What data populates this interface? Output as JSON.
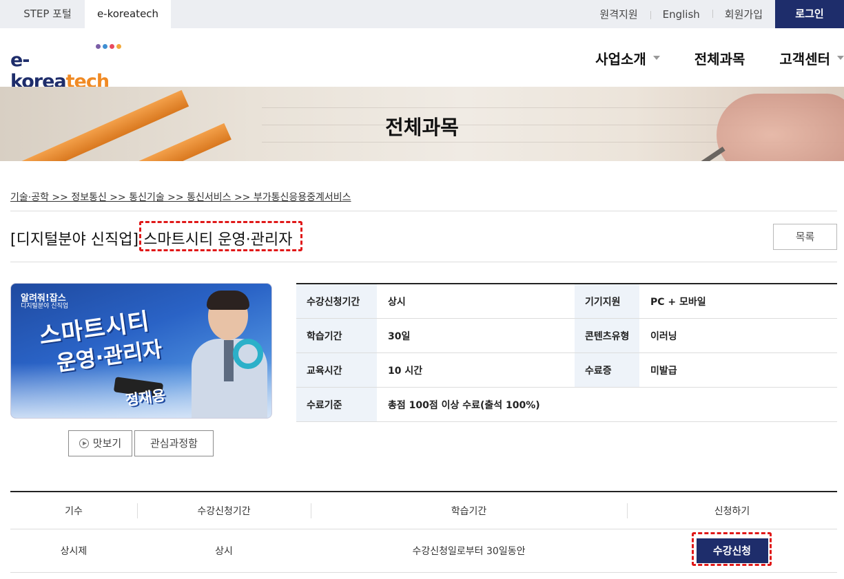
{
  "topbar": {
    "tabs": [
      {
        "label": "STEP 포털"
      },
      {
        "label": "e-koreatech"
      }
    ],
    "links": [
      "원격지원",
      "English",
      "회원가입"
    ],
    "login_label": "로그인"
  },
  "header": {
    "logo": {
      "prefix": "e-korea",
      "suffix": "tech",
      "dot_colors": [
        "#7b5ea7",
        "#3f8fd2",
        "#e84a5f",
        "#f2a93b"
      ]
    },
    "nav": [
      {
        "label": "사업소개",
        "has_dropdown": true
      },
      {
        "label": "전체과목",
        "has_dropdown": false
      },
      {
        "label": "고객센터",
        "has_dropdown": true
      }
    ]
  },
  "banner": {
    "title": "전체과목"
  },
  "breadcrumb": "기술·공학 >> 정보통신 >> 통신기술 >> 통신서비스 >> 부가통신응용중계서비스",
  "course": {
    "title_prefix": "[디지털분야 신직업] ",
    "title_main": "스마트시티 운영·관리자",
    "list_button": "목록"
  },
  "thumbnail": {
    "brand": "알려줘!잡스",
    "sub": "디지털분야 신직업",
    "line1": "스마트시티",
    "line2": "운영·관리자",
    "instructor": "정재용"
  },
  "buttons": {
    "preview": "맛보기",
    "interest": "관심과정함"
  },
  "info": {
    "rows": [
      {
        "label1": "수강신청기간",
        "value1": "상시",
        "label2": "기기지원",
        "value2": "PC + 모바일"
      },
      {
        "label1": "학습기간",
        "value1": "30일",
        "label2": "콘텐츠유형",
        "value2": "이러닝"
      },
      {
        "label1": "교육시간",
        "value1": "10 시간",
        "label2": "수료증",
        "value2": "미발급"
      }
    ],
    "last": {
      "label": "수료기준",
      "value": "총점 100점 이상 수료(출석 100%)"
    }
  },
  "schedule": {
    "headers": [
      "기수",
      "수강신청기간",
      "학습기간",
      "신청하기"
    ],
    "rows": [
      {
        "term": "상시제",
        "enroll_period": "상시",
        "study_period": "수강신청일로부터 30일동안",
        "apply_label": "수강신청"
      }
    ]
  },
  "colors": {
    "primary": "#1e2d6b",
    "accent": "#f08a24",
    "highlight_dash": "#e01818"
  }
}
